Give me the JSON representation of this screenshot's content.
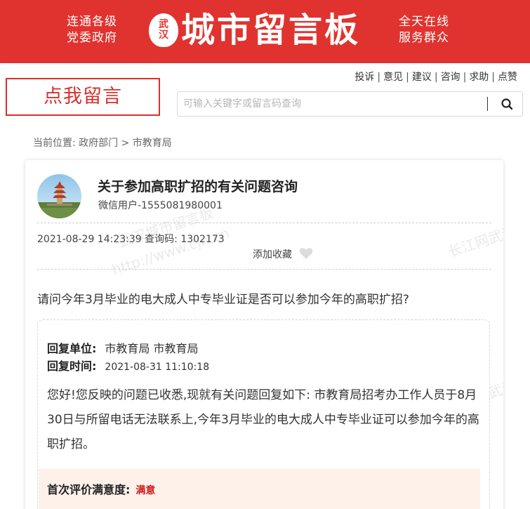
{
  "banner": {
    "slogan_left_1": "连通各级",
    "slogan_left_2": "党委政府",
    "logo_seal_1": "武",
    "logo_seal_2": "汉",
    "title": "城市留言板",
    "slogan_right_1": "全天在线",
    "slogan_right_2": "服务群众",
    "color": "#e0332f"
  },
  "nav": {
    "links": [
      "投诉",
      "意见",
      "建议",
      "咨询",
      "求助",
      "点赞"
    ],
    "separator": "|"
  },
  "cta": {
    "label": "点我留言"
  },
  "search": {
    "placeholder": "可输入关键字或留言码查询",
    "icon": "search-icon"
  },
  "breadcrumb": {
    "prefix": "当前位置:",
    "path": "政府部门 > 市教育局"
  },
  "message": {
    "title": "关于参加高职扩招的有关问题咨询",
    "user": "微信用户-1555081980001",
    "datetime": "2021-08-29 14:23:39",
    "code_label": "查询码:",
    "code": "1302173",
    "favorite_label": "添加收藏",
    "favorite_icon": "heart-icon",
    "question": "请问今年3月毕业的电大成人中专毕业证是否可以参加今年的高职扩招?"
  },
  "reply": {
    "unit_label": "回复单位:",
    "unit_value": "市教育局 市教育局",
    "time_label": "回复时间:",
    "time_value": "2021-08-31 11:10:18",
    "text": "您好!您反映的问题已收悉,现就有关问题回复如下: 市教育局招考办工作人员于8月30日与所留电话无法联系上,今年3月毕业的电大成人中专毕业证可以参加今年的高职扩招。",
    "rating_label": "首次评价满意度:",
    "rating_value": "满意",
    "rating_color": "#cc1a1a"
  },
  "watermark": {
    "text_1": "武汉城市留言板",
    "text_2": "长江网武汉",
    "text_3": "http://www.cjn.cn"
  }
}
